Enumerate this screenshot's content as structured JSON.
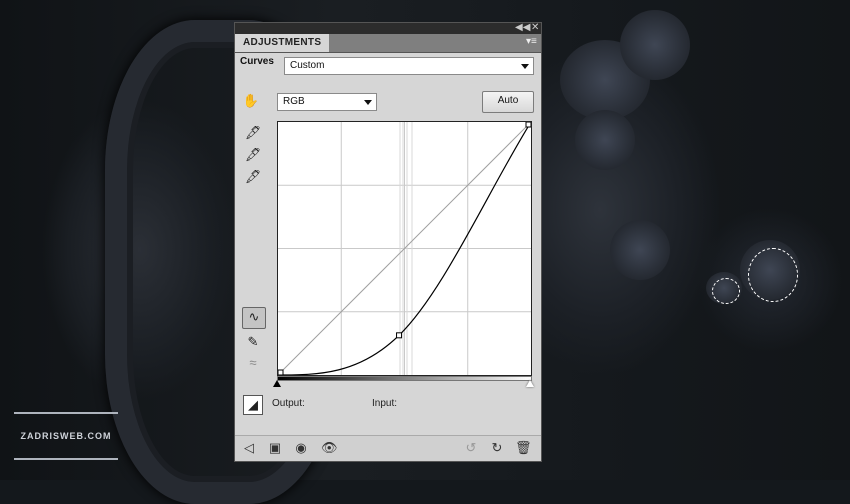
{
  "panel": {
    "tab_label": "ADJUSTMENTS",
    "curves_label": "Curves",
    "preset_value": "Custom",
    "channel_value": "RGB",
    "auto_button": "Auto",
    "output_label": "Output:",
    "input_label": "Input:"
  },
  "curve": {
    "points": [
      [
        0,
        0
      ],
      [
        122,
        40
      ],
      [
        255,
        255
      ]
    ]
  },
  "watermark": {
    "text": "ZADRISWEB.COM"
  },
  "icons": {
    "collapse": "double-chevron-icon",
    "close": "close-icon",
    "panel_menu": "panel-menu-icon",
    "on_image_adjust": "hand-adjust-icon",
    "black_eyedropper": "eyedropper-black-icon",
    "gray_eyedropper": "eyedropper-gray-icon",
    "white_eyedropper": "eyedropper-white-icon",
    "curve_tool": "curve-tool-icon",
    "pencil_tool": "pencil-icon",
    "smooth_tool": "smooth-icon",
    "clipping_warning": "clipping-warning-icon",
    "back": "back-arrow-icon",
    "clip_layer": "clip-layer-icon",
    "mask": "mask-icon",
    "visibility": "eye-icon",
    "view_previous": "view-previous-icon",
    "reset": "reset-icon",
    "delete": "trash-icon"
  },
  "colors": {
    "panel_bg": "#d6d6d6",
    "selection": "#ffffff"
  }
}
